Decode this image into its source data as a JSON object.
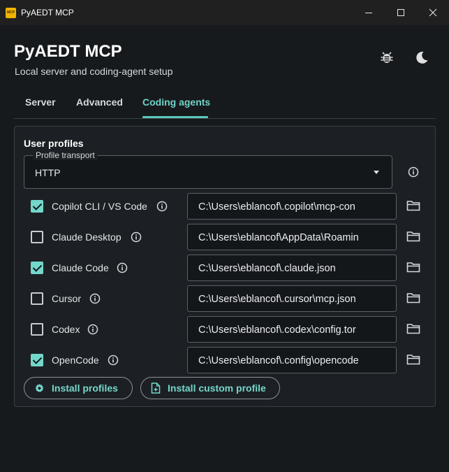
{
  "window": {
    "title": "PyAEDT MCP",
    "icon_text": "MCP"
  },
  "header": {
    "title": "PyAEDT MCP",
    "subtitle": "Local server and coding-agent setup",
    "icons": [
      "bug-icon",
      "dark-mode-moon-icon"
    ]
  },
  "tabs": [
    {
      "label": "Server",
      "active": false
    },
    {
      "label": "Advanced",
      "active": false
    },
    {
      "label": "Coding agents",
      "active": true
    }
  ],
  "panel": {
    "title": "User profiles",
    "transport": {
      "legend": "Profile transport",
      "value": "HTTP"
    },
    "profiles": [
      {
        "label": "Copilot CLI / VS Code",
        "checked": true,
        "path": "C:\\Users\\eblancof\\.copilot\\mcp-con"
      },
      {
        "label": "Claude Desktop",
        "checked": false,
        "path": "C:\\Users\\eblancof\\AppData\\Roamin"
      },
      {
        "label": "Claude Code",
        "checked": true,
        "path": "C:\\Users\\eblancof\\.claude.json"
      },
      {
        "label": "Cursor",
        "checked": false,
        "path": "C:\\Users\\eblancof\\.cursor\\mcp.json"
      },
      {
        "label": "Codex",
        "checked": false,
        "path": "C:\\Users\\eblancof\\.codex\\config.tor"
      },
      {
        "label": "OpenCode",
        "checked": true,
        "path": "C:\\Users\\eblancof\\.config\\opencode"
      }
    ],
    "buttons": {
      "install_profiles": "Install profiles",
      "install_custom": "Install custom profile"
    }
  },
  "colors": {
    "accent": "#74d7cb",
    "background": "#171a1d",
    "titlebar": "#202020"
  }
}
